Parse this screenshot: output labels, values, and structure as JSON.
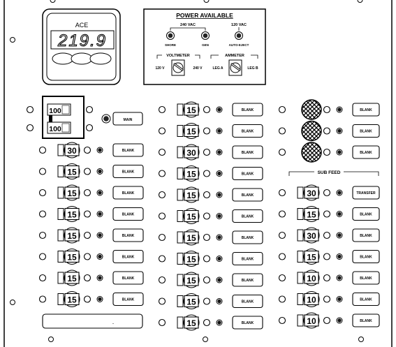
{
  "meter": {
    "brand": "ACE",
    "reading": "219.9"
  },
  "power_available": {
    "title": "POWER AVAILABLE",
    "group_240": "240 VAC",
    "group_120": "120 VAC",
    "indicators": [
      "SHORE",
      "GEN",
      "AUTO-EJECT"
    ]
  },
  "voltmeter": {
    "title": "VOLTMETER",
    "left": "120 V",
    "right": "240 V"
  },
  "ammeter": {
    "title": "AMMETER",
    "left": "LEG A",
    "right": "LEG B"
  },
  "main_breaker": {
    "ratings": [
      "100",
      "100"
    ],
    "label": "MAIN"
  },
  "left_column": [
    {
      "rating": "30",
      "label": "BLANK"
    },
    {
      "rating": "15",
      "label": "BLANK"
    },
    {
      "rating": "15",
      "label": "BLANK"
    },
    {
      "rating": "15",
      "label": "BLANK"
    },
    {
      "rating": "15",
      "label": "BLANK"
    },
    {
      "rating": "15",
      "label": "BLANK"
    },
    {
      "rating": "15",
      "label": "BLANK"
    },
    {
      "rating": "15",
      "label": "BLANK"
    }
  ],
  "left_footer": ".",
  "middle_column": [
    {
      "rating": "15",
      "label": "BLANK"
    },
    {
      "rating": "15",
      "label": "BLANK"
    },
    {
      "rating": "30",
      "label": "BLANK"
    },
    {
      "rating": "15",
      "label": "BLANK"
    },
    {
      "rating": "15",
      "label": "BLANK"
    },
    {
      "rating": "15",
      "label": "BLANK"
    },
    {
      "rating": "15",
      "label": "BLANK"
    },
    {
      "rating": "15",
      "label": "BLANK"
    },
    {
      "rating": "15",
      "label": "BLANK"
    },
    {
      "rating": "15",
      "label": "BLANK"
    },
    {
      "rating": "15",
      "label": "BLANK"
    }
  ],
  "right_top": [
    {
      "label": "BLANK"
    },
    {
      "label": "BLANK"
    },
    {
      "label": "BLANK"
    }
  ],
  "sub_feed": {
    "title": "SUB FEED",
    "rows": [
      {
        "rating": "30",
        "label": "TRANSFER"
      },
      {
        "rating": "15",
        "label": "BLANK"
      },
      {
        "rating": "30",
        "label": "BLANK"
      },
      {
        "rating": "15",
        "label": "BLANK"
      },
      {
        "rating": "10",
        "label": "BLANK"
      },
      {
        "rating": "10",
        "label": "BLANK"
      },
      {
        "rating": "10",
        "label": "BLANK"
      }
    ]
  }
}
